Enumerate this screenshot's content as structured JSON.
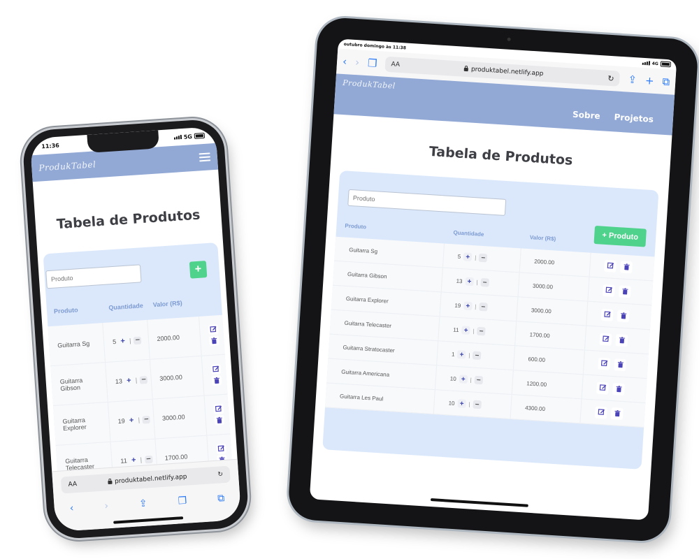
{
  "app": {
    "logo": "ProdukTabel",
    "title": "Tabela de Produtos",
    "nav": [
      "Sobre",
      "Projetos"
    ],
    "search_placeholder": "Produto",
    "add_button": "Produto",
    "columns": [
      "Produto",
      "Quantidade",
      "Valor (R$)"
    ],
    "columns_phone_value": "Valor (R$)",
    "products": [
      {
        "name": "Guitarra Sg",
        "qty": "5",
        "value": "2000.00"
      },
      {
        "name": "Guitarra Gibson",
        "qty": "13",
        "value": "3000.00"
      },
      {
        "name": "Guitarra Explorer",
        "qty": "19",
        "value": "3000.00"
      },
      {
        "name": "Guitarra Telecaster",
        "qty": "11",
        "value": "1700.00"
      },
      {
        "name": "Guitarra Stratocaster",
        "qty": "1",
        "value": "600.00"
      },
      {
        "name": "Guitarra Americana",
        "qty": "10",
        "value": "1200.00"
      },
      {
        "name": "Guitarra Les Paul",
        "qty": "10",
        "value": "4300.00"
      }
    ]
  },
  "phone": {
    "time": "11:36",
    "network": "5G",
    "url": "produktabel.netlify.app",
    "aa": "AA"
  },
  "tablet": {
    "time": "outubro domingo às 11:38",
    "network": "4G",
    "url": "produktabel.netlify.app",
    "aa": "AA"
  },
  "icons": {
    "back": "chevron-left-icon",
    "forward": "chevron-right-icon",
    "bookmarks": "book-icon",
    "share": "share-icon",
    "add_tab": "plus-icon",
    "tabs": "tabs-icon",
    "edit": "edit-icon",
    "delete": "trash-icon"
  },
  "colors": {
    "navbar": "#92a9d6",
    "card": "#dbe8fb",
    "add_button": "#4fd38c",
    "header_text": "#7d9bd3",
    "accent": "#4b43b8",
    "safari_blue": "#2f7cf6"
  }
}
